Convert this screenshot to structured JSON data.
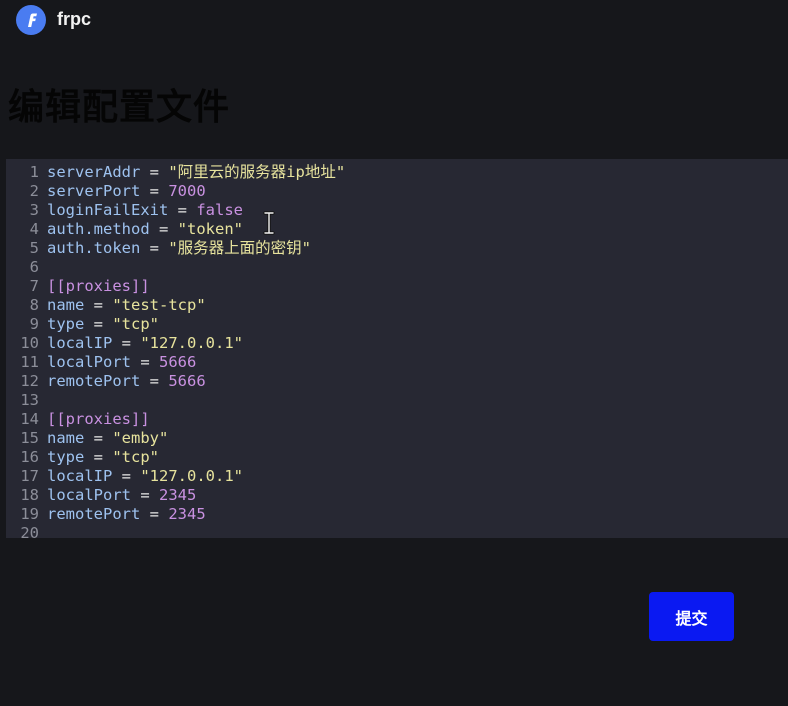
{
  "header": {
    "app_name": "frpc",
    "logo_icon": "frp-logo-icon"
  },
  "page": {
    "title": "编辑配置文件"
  },
  "editor": {
    "lines": [
      {
        "num": "1",
        "tokens": [
          {
            "t": "serverAddr",
            "c": "key"
          },
          {
            "t": " = ",
            "c": "op"
          },
          {
            "t": "\"阿里云的服务器ip地址\"",
            "c": "str"
          }
        ]
      },
      {
        "num": "2",
        "tokens": [
          {
            "t": "serverPort",
            "c": "key"
          },
          {
            "t": " = ",
            "c": "op"
          },
          {
            "t": "7000",
            "c": "num"
          }
        ]
      },
      {
        "num": "3",
        "tokens": [
          {
            "t": "loginFailExit",
            "c": "key"
          },
          {
            "t": " = ",
            "c": "op"
          },
          {
            "t": "false",
            "c": "bool"
          }
        ]
      },
      {
        "num": "4",
        "tokens": [
          {
            "t": "auth.method",
            "c": "key"
          },
          {
            "t": " = ",
            "c": "op"
          },
          {
            "t": "\"token\"",
            "c": "str"
          }
        ]
      },
      {
        "num": "5",
        "tokens": [
          {
            "t": "auth.token",
            "c": "key"
          },
          {
            "t": " = ",
            "c": "op"
          },
          {
            "t": "\"服务器上面的密钥\"",
            "c": "str"
          }
        ]
      },
      {
        "num": "6",
        "tokens": []
      },
      {
        "num": "7",
        "tokens": [
          {
            "t": "[[proxies]]",
            "c": "section"
          }
        ]
      },
      {
        "num": "8",
        "tokens": [
          {
            "t": "name",
            "c": "key"
          },
          {
            "t": " = ",
            "c": "op"
          },
          {
            "t": "\"test-tcp\"",
            "c": "str"
          }
        ]
      },
      {
        "num": "9",
        "tokens": [
          {
            "t": "type",
            "c": "key"
          },
          {
            "t": " = ",
            "c": "op"
          },
          {
            "t": "\"tcp\"",
            "c": "str"
          }
        ]
      },
      {
        "num": "10",
        "tokens": [
          {
            "t": "localIP",
            "c": "key"
          },
          {
            "t": " = ",
            "c": "op"
          },
          {
            "t": "\"127.0.0.1\"",
            "c": "str"
          }
        ]
      },
      {
        "num": "11",
        "tokens": [
          {
            "t": "localPort",
            "c": "key"
          },
          {
            "t": " = ",
            "c": "op"
          },
          {
            "t": "5666",
            "c": "num"
          }
        ]
      },
      {
        "num": "12",
        "tokens": [
          {
            "t": "remotePort",
            "c": "key"
          },
          {
            "t": " = ",
            "c": "op"
          },
          {
            "t": "5666",
            "c": "num"
          }
        ]
      },
      {
        "num": "13",
        "tokens": []
      },
      {
        "num": "14",
        "tokens": [
          {
            "t": "[[proxies]]",
            "c": "section"
          }
        ]
      },
      {
        "num": "15",
        "tokens": [
          {
            "t": "name",
            "c": "key"
          },
          {
            "t": " = ",
            "c": "op"
          },
          {
            "t": "\"emby\"",
            "c": "str"
          }
        ]
      },
      {
        "num": "16",
        "tokens": [
          {
            "t": "type",
            "c": "key"
          },
          {
            "t": " = ",
            "c": "op"
          },
          {
            "t": "\"tcp\"",
            "c": "str"
          }
        ]
      },
      {
        "num": "17",
        "tokens": [
          {
            "t": "localIP",
            "c": "key"
          },
          {
            "t": " = ",
            "c": "op"
          },
          {
            "t": "\"127.0.0.1\"",
            "c": "str"
          }
        ]
      },
      {
        "num": "18",
        "tokens": [
          {
            "t": "localPort",
            "c": "key"
          },
          {
            "t": " = ",
            "c": "op"
          },
          {
            "t": "2345",
            "c": "num"
          }
        ]
      },
      {
        "num": "19",
        "tokens": [
          {
            "t": "remotePort",
            "c": "key"
          },
          {
            "t": " = ",
            "c": "op"
          },
          {
            "t": "2345",
            "c": "num"
          }
        ]
      },
      {
        "num": "20",
        "tokens": []
      }
    ],
    "cursor_icon": "text-cursor-icon"
  },
  "actions": {
    "submit_label": "提交"
  },
  "colors": {
    "background": "#16171b",
    "editor_background": "#272833",
    "key": "#9ec2ef",
    "string": "#e7e39d",
    "number": "#c991e1",
    "accent_button": "#0a19f2",
    "logo": "#4a7cf1"
  }
}
